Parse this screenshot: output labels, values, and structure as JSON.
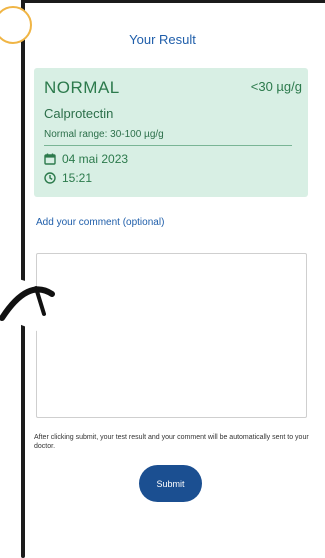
{
  "header": {
    "title": "Your Result"
  },
  "result": {
    "status": "NORMAL",
    "value": "<30 µg/g",
    "test_name": "Calprotectin",
    "normal_range": "Normal range: 30-100 µg/g",
    "date": "04 mai 2023",
    "time": "15:21",
    "date_icon": "calendar-icon",
    "time_icon": "clock-icon"
  },
  "comment": {
    "label": "Add your comment (optional)",
    "value": "",
    "placeholder": ""
  },
  "footer": {
    "notice": "After clicking submit, your test result and your comment will be automatically sent to your doctor.",
    "submit_label": "Submit"
  },
  "colors": {
    "accent_blue": "#1f5eaa",
    "button_blue": "#1b4f91",
    "card_green": "#d8efe4",
    "status_green": "#2c7a4c",
    "highlight_yellow": "#f0b545"
  }
}
